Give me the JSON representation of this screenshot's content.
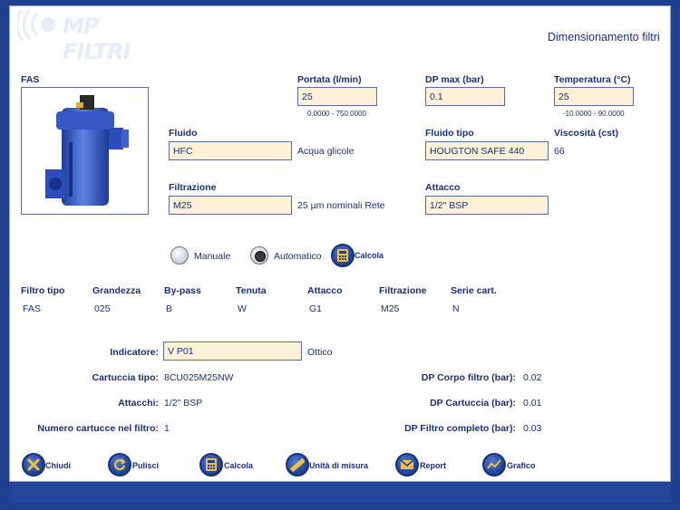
{
  "header": {
    "logo_text": "MP FILTRI",
    "title": "Dimensionamento filtri"
  },
  "product": {
    "name": "FAS"
  },
  "inputs": {
    "portata": {
      "label": "Portata (l/min)",
      "value": "25",
      "range": "0.0000 - 750.0000"
    },
    "dp_max": {
      "label": "DP max (bar)",
      "value": "0.1"
    },
    "temperatura": {
      "label": "Temperatura (°C)",
      "value": "25",
      "range": "-10.0000 - 90.0000"
    },
    "fluido": {
      "label": "Fluido",
      "value": "HFC",
      "desc": "Acqua glicole"
    },
    "fluido_tipo": {
      "label": "Fluido tipo",
      "value": "HOUGTON SAFE 440"
    },
    "viscosita": {
      "label": "Viscosità (cst)",
      "value": "66"
    },
    "filtrazione": {
      "label": "Filtrazione",
      "value": "M25",
      "desc": "25 µm nominali Rete"
    },
    "attacco": {
      "label": "Attacco",
      "value": "1/2\" BSP"
    }
  },
  "mode": {
    "manuale": "Manuale",
    "automatico": "Automatico",
    "selected": "Automatico",
    "calcola": "Calcola"
  },
  "result_table": {
    "headers": [
      "Filtro tipo",
      "Grandezza",
      "By-pass",
      "Tenuta",
      "Attacco",
      "Filtrazione",
      "Serie cart."
    ],
    "row": [
      "FAS",
      "025",
      "B",
      "W",
      "G1",
      "M25",
      "N"
    ]
  },
  "details": {
    "indicatore_label": "Indicatore:",
    "indicatore_value": "V P01",
    "indicatore_desc": "Ottico",
    "cartuccia_label": "Cartuccia tipo:",
    "cartuccia_value": "8CU025M25NW",
    "attacchi_label": "Attacchi:",
    "attacchi_value": "1/2\" BSP",
    "numero_label": "Numero cartucce nel filtro:",
    "numero_value": "1",
    "dp_corpo_label": "DP Corpo filtro (bar):",
    "dp_corpo_value": "0.02",
    "dp_cartuccia_label": "DP Cartuccia (bar):",
    "dp_cartuccia_value": "0.01",
    "dp_completo_label": "DP Filtro completo (bar):",
    "dp_completo_value": "0.03"
  },
  "toolbar": {
    "chiudi": "Chiudi",
    "pulisci": "Pulisci",
    "calcola": "Calcola",
    "unita": "Unità di misura",
    "report": "Report",
    "grafico": "Grafico"
  },
  "colors": {
    "text": "#1a2f7a",
    "field_bg": "#fdf1d8",
    "bar": "#23469a",
    "button": "#1b3d91"
  }
}
